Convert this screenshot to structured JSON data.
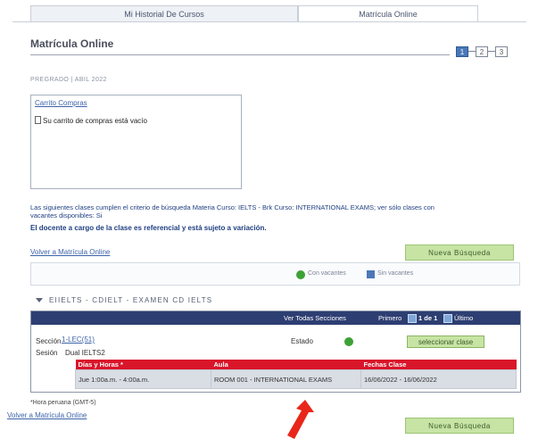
{
  "tabs": [
    {
      "label": "Mi Historial De Cursos",
      "active": false
    },
    {
      "label": "Matrícula Online",
      "active": true
    }
  ],
  "page_title": "Matrícula Online",
  "steps": [
    "1",
    "2",
    "3"
  ],
  "term": "PREGRADO | ABIL 2022",
  "cart": {
    "title": "Carrito Compras",
    "empty_message": "Su carrito de compras está vacío"
  },
  "criteria_text": "Las siguientes clases cumplen el criterio de búsqueda Materia Curso: IELTS - Brk Curso: INTERNATIONAL EXAMS; ver sólo clases con vacantes disponibles: Si",
  "warning_text": "El docente a cargo de la clase es referencial y está sujeto a variación.",
  "back_link": "Volver a Matrícula Online",
  "new_search_label": "Nueva Búsqueda",
  "legend": {
    "open_label": "Con vacantes",
    "closed_label": "Sin vacantes"
  },
  "course_title": "EIIELTS - CDIELT - EXAMEN CD IELTS",
  "section_bar": {
    "view_all": "Ver Todas Secciones",
    "first": "Primero",
    "page": "1 de 1",
    "last": "Último"
  },
  "section": {
    "label": "Sección",
    "value": "1-LEC(51)",
    "session_label": "Sesión",
    "session_value": "Dual IELTS2",
    "status_label": "Estado",
    "select_label": "seleccionar clase"
  },
  "schedule_table": {
    "headers": [
      "Días y Horas *",
      "Aula",
      "Fechas Clase"
    ],
    "rows": [
      [
        "Jue 1:00a.m. - 4:00a.m.",
        "ROOM 001 - INTERNATIONAL EXAMS",
        "16/06/2022 - 16/06/2022"
      ]
    ]
  },
  "footnote": "*Hora peruana (GMT-5)",
  "colors": {
    "header_bar": "#2d3e72",
    "table_header": "#d9152a",
    "green_button": "#c7e4a4",
    "open_dot": "#3da236",
    "arrow": "#e8271a"
  }
}
